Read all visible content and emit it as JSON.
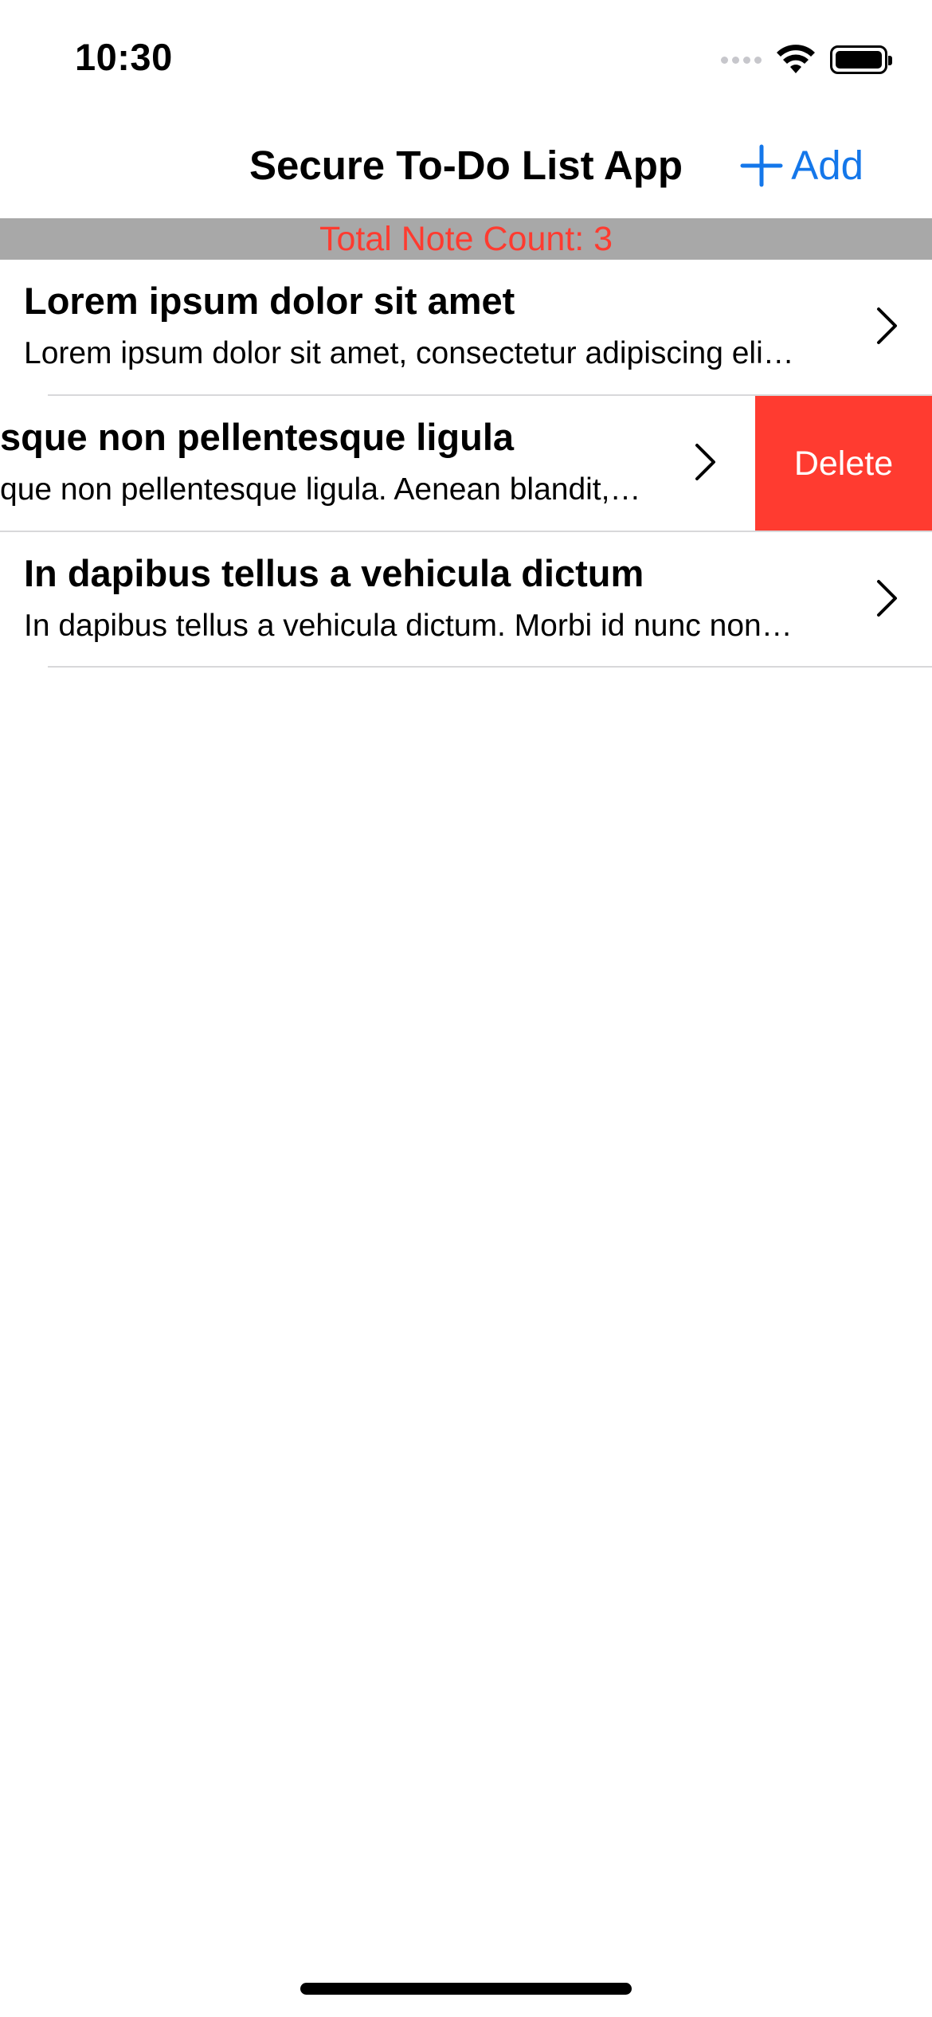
{
  "status_bar": {
    "time": "10:30",
    "icons": [
      "cellular-dots-icon",
      "wifi-icon",
      "battery-icon"
    ]
  },
  "nav": {
    "title": "Secure To-Do List App",
    "add_label": "Add",
    "add_icon": "plus-icon"
  },
  "header": {
    "count_text": "Total Note Count: 3"
  },
  "notes": [
    {
      "title": "Lorem ipsum dolor sit amet",
      "subtitle": "Lorem ipsum dolor sit amet, consectetur adipiscing eli…"
    },
    {
      "title": "sque non pellentesque ligula",
      "subtitle": "que non pellentesque ligula. Aenean blandit,…",
      "swipe_action": "Delete"
    },
    {
      "title": "In dapibus tellus a vehicula dictum",
      "subtitle": "In dapibus tellus a vehicula dictum. Morbi id nunc non…"
    }
  ],
  "colors": {
    "accent": "#1477ea",
    "destructive": "#ff3b30",
    "header_bg": "#a8a8a8"
  }
}
